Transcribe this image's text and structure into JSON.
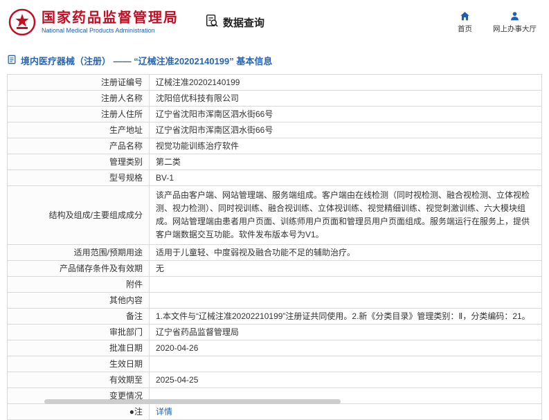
{
  "header": {
    "agency_cn": "国家药品监督管理局",
    "agency_en": "National Medical Products Administration",
    "nav_query": "数据查询",
    "nav_home": "首页",
    "nav_hall": "网上办事大厅"
  },
  "breadcrumb": {
    "text": "境内医疗器械（注册） ——  “辽械注准20202140199”  基本信息"
  },
  "table": {
    "rows": [
      {
        "label": "注册证编号",
        "value": "辽械注准20202140199"
      },
      {
        "label": "注册人名称",
        "value": "沈阳倍优科技有限公司"
      },
      {
        "label": "注册人住所",
        "value": "辽宁省沈阳市浑南区泗水街66号"
      },
      {
        "label": "生产地址",
        "value": "辽宁省沈阳市浑南区泗水街66号"
      },
      {
        "label": "产品名称",
        "value": "视觉功能训练治疗软件"
      },
      {
        "label": "管理类别",
        "value": "第二类"
      },
      {
        "label": "型号规格",
        "value": "BV-1"
      },
      {
        "label": "结构及组成/主要组成成分",
        "value": "该产品由客户端、网站管理端、服务端组成。客户端由在线检测（同时视检测、融合视检测、立体视检测、视力检测）、同时视训练、融合视训练、立体视训练、视觉精细训练、视觉刺激训练、六大模块组成。网站管理端由患者用户页面、训练师用户页面和管理员用户页面组成。服务端运行在服务上，提供客户端数据交互功能。软件发布版本号为V1。",
        "tall": true
      },
      {
        "label": "适用范围/预期用途",
        "value": "适用于儿童轻、中度弱视及融合功能不足的辅助治疗。"
      },
      {
        "label": "产品储存条件及有效期",
        "value": "无"
      },
      {
        "label": "附件",
        "value": ""
      },
      {
        "label": "其他内容",
        "value": ""
      },
      {
        "label": "备注",
        "value": "1.本文件与“辽械注准20202210199”注册证共同使用。2.新《分类目录》管理类别：Ⅱ，分类编码：21。"
      },
      {
        "label": "审批部门",
        "value": "辽宁省药品监督管理局"
      },
      {
        "label": "批准日期",
        "value": "2020-04-26"
      },
      {
        "label": "生效日期",
        "value": ""
      },
      {
        "label": "有效期至",
        "value": "2025-04-25"
      },
      {
        "label": "变更情况",
        "value": ""
      },
      {
        "label": "●注",
        "value": "详情",
        "value_is_link": true
      }
    ]
  },
  "icons": {
    "emblem": "national-emblem-icon",
    "query": "document-search-icon",
    "home": "home-icon",
    "hall": "person-icon",
    "breadcrumb": "document-icon"
  },
  "colors": {
    "brand_red": "#c30d23",
    "brand_blue": "#1f5fae",
    "link_blue": "#1a66b3",
    "border_gray": "#d9d9d9"
  }
}
